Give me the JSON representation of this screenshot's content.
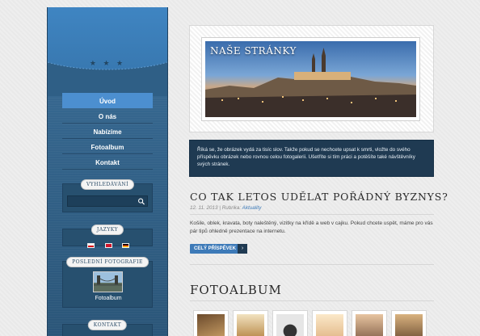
{
  "sidebar": {
    "stars": "★ ★ ★",
    "menu": [
      {
        "label": "Úvod",
        "active": true
      },
      {
        "label": "O nás",
        "active": false
      },
      {
        "label": "Nabízíme",
        "active": false
      },
      {
        "label": "Fotoalbum",
        "active": false
      },
      {
        "label": "Kontakt",
        "active": false
      }
    ],
    "search": {
      "title": "VYHLEDÁVÁNÍ",
      "value": ""
    },
    "languages": {
      "title": "JAZYKY"
    },
    "latest_photos": {
      "title": "POSLEDNÍ FOTOGRAFIE",
      "caption": "Fotoalbum"
    },
    "contact": {
      "title": "KONTAKT"
    }
  },
  "header": {
    "site_title": "NAŠE STRÁNKY"
  },
  "intro": {
    "text": "Říká se, že obrázek vydá za tisíc slov. Takže pokud se nechcete upsat k smrti, vložte do svého příspěvku obrázek nebo rovnou celou fotogalerii. Ušetříte si tím práci a potěšíte také návštěvníky svých stránek."
  },
  "post": {
    "title": "CO TAK LETOS UDĚLAT POŘÁDNÝ BYZNYS?",
    "date": "12. 11. 2013",
    "separator": " | ",
    "category_label": "Rubrika: ",
    "category": "Aktuality",
    "body": "Košile, oblek, kravata, boty naleštěný, vizitky na křídě a web v cajku. Pokud chcete uspět, máme pro vás pár tipů ohledně prezentace na internetu.",
    "read_more": "CELÝ PŘÍSPĚVEK",
    "arrow": "›"
  },
  "gallery": {
    "title": "FOTOALBUM",
    "thumbs": [
      {
        "color": "#a0784a"
      },
      {
        "color": "#c9a15f"
      },
      {
        "color": "#d9d9d9"
      },
      {
        "color": "#e9c8a0"
      },
      {
        "color": "#cfa38a"
      },
      {
        "color": "#e0b08a"
      },
      {
        "color": "#8fb0d0"
      }
    ]
  }
}
